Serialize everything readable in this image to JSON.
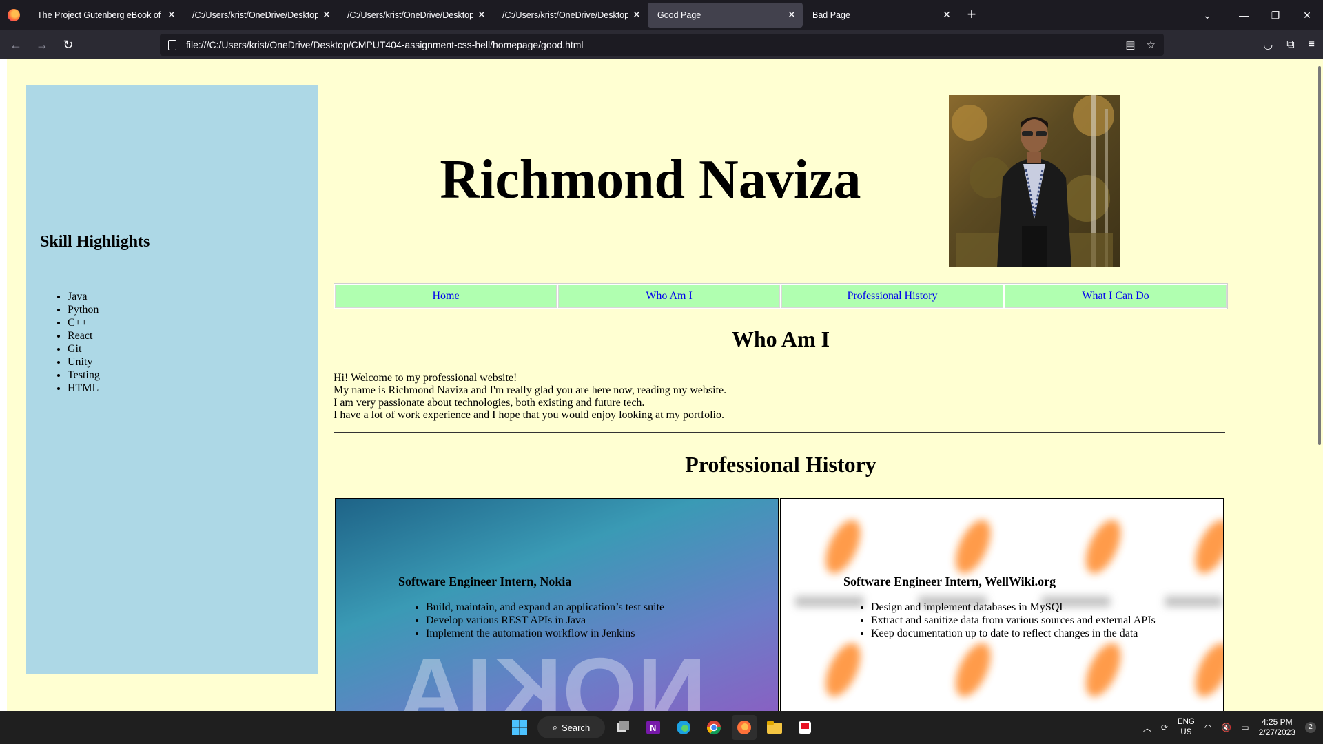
{
  "browser": {
    "tabs": [
      {
        "label": "The Project Gutenberg eBook of Fra",
        "active": false
      },
      {
        "label": "/C:/Users/krist/OneDrive/Desktop/C",
        "active": false
      },
      {
        "label": "/C:/Users/krist/OneDrive/Desktop/C",
        "active": false
      },
      {
        "label": "/C:/Users/krist/OneDrive/Desktop/C",
        "active": false
      },
      {
        "label": "Good Page",
        "active": true
      },
      {
        "label": "Bad Page",
        "active": false
      }
    ],
    "url": "file:///C:/Users/krist/OneDrive/Desktop/CMPUT404-assignment-css-hell/homepage/good.html",
    "new_tab_symbol": "+",
    "close_symbol": "✕"
  },
  "page": {
    "sidebar": {
      "heading": "Skill Highlights",
      "skills": [
        "Java",
        "Python",
        "C++",
        "React",
        "Git",
        "Unity",
        "Testing",
        "HTML"
      ]
    },
    "title": "Richmond Naviza",
    "nav": [
      "Home",
      "Who Am I",
      "Professional History",
      "What I Can Do"
    ],
    "who_heading": "Who Am I",
    "intro_lines": [
      "Hi! Welcome to my professional website!",
      "My name is Richmond Naviza and I'm really glad you are here now, reading my website.",
      "I am very passionate about technologies, both existing and future tech.",
      "I have a lot of work experience and I hope that you would enjoy looking at my portfolio."
    ],
    "history_heading": "Professional History",
    "jobs": [
      {
        "title": "Software Engineer Intern, Nokia",
        "bullets": [
          "Build, maintain, and expand an application’s test suite",
          "Develop various REST APIs in Java",
          "Implement the automation workflow in Jenkins"
        ],
        "bg_text": "NOKIA"
      },
      {
        "title": "Software Engineer Intern, WellWiki.org",
        "bullets": [
          "Design and implement databases in MySQL",
          "Extract and sanitize data from various sources and external APIs",
          "Keep documentation up to date to reflect changes in the data"
        ]
      }
    ]
  },
  "taskbar": {
    "search_label": "Search",
    "lang_line1": "ENG",
    "lang_line2": "US",
    "time": "4:25 PM",
    "date": "2/27/2023",
    "notification_count": "2"
  }
}
